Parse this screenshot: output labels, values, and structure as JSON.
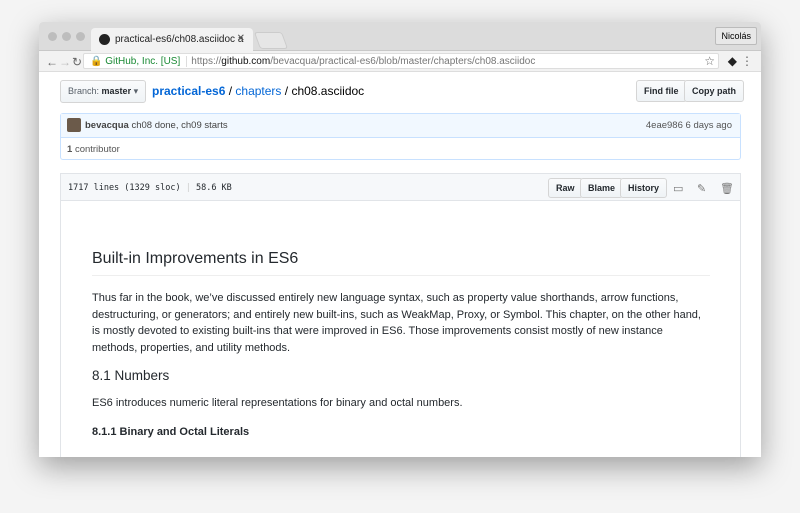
{
  "browser": {
    "tab_title": "practical-es6/ch08.asciidoc a",
    "user": "Nicolás",
    "secure_label": "GitHub, Inc. [US]",
    "url_scheme": "https://",
    "url_host": "github.com",
    "url_path": "/bevacqua/practical-es6/blob/master/chapters/ch08.asciidoc"
  },
  "repo": {
    "branch_label": "Branch:",
    "branch": "master",
    "repo": "practical-es6",
    "folder": "chapters",
    "file": "ch08.asciidoc",
    "find_file": "Find file",
    "copy_path": "Copy path"
  },
  "commit": {
    "author": "bevacqua",
    "message": "ch08 done, ch09 starts",
    "sha": "4eae986",
    "age": "6 days ago",
    "contributors_count": "1",
    "contributors_label": "contributor"
  },
  "file": {
    "lines": "1717 lines (1329 sloc)",
    "size": "58.6 KB",
    "raw": "Raw",
    "blame": "Blame",
    "history": "History"
  },
  "content": {
    "h1": "Built-in Improvements in ES6",
    "p1": "Thus far in the book, we’ve discussed entirely new language syntax, such as property value shorthands, arrow functions, destructuring, or generators; and entirely new built-ins, such as WeakMap, Proxy, or Symbol. This chapter, on the other hand, is mostly devoted to existing built-ins that were improved in ES6. Those improvements consist mostly of new instance methods, properties, and utility methods.",
    "h2": "8.1 Numbers",
    "p2": "ES6 introduces numeric literal representations for binary and octal numbers.",
    "h3": "8.1.1 Binary and Octal Literals"
  }
}
